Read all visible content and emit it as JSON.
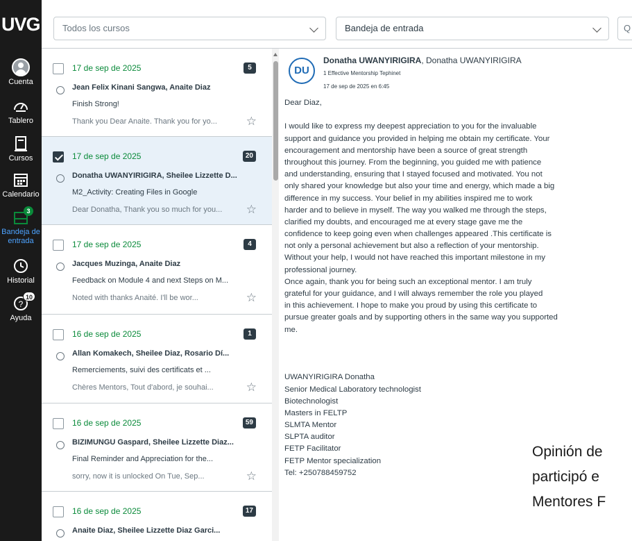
{
  "nav": {
    "logo": "UVG",
    "items": [
      {
        "label": "Cuenta",
        "icon": "account-icon"
      },
      {
        "label": "Tablero",
        "icon": "dashboard-icon"
      },
      {
        "label": "Cursos",
        "icon": "courses-icon"
      },
      {
        "label": "Calendario",
        "icon": "calendar-icon"
      },
      {
        "label": "Bandeja de entrada",
        "icon": "inbox-icon",
        "badge": "3"
      },
      {
        "label": "Historial",
        "icon": "history-icon"
      },
      {
        "label": "Ayuda",
        "icon": "help-icon",
        "badge": "10"
      }
    ]
  },
  "toolbar": {
    "course_filter": "Todos los cursos",
    "mailbox_filter": "Bandeja de entrada",
    "search_stub": "Q"
  },
  "conversations": [
    {
      "date": "17 de sep de 2025",
      "count": "5",
      "names": "Jean Felix Kinani Sangwa, Anaite Diaz",
      "subject": "Finish Strong!",
      "preview": "Thank you Dear Anaite. Thank you for yo...",
      "selected": false
    },
    {
      "date": "17 de sep de 2025",
      "count": "20",
      "names": "Donatha UWANYIRIGIRA, Sheilee Lizzette D...",
      "subject": "M2_Activity: Creating Files in Google",
      "preview": "Dear Donatha, Thank you so much for you...",
      "selected": true
    },
    {
      "date": "17 de sep de 2025",
      "count": "4",
      "names": "Jacques Muzinga, Anaite Diaz",
      "subject": "Feedback on Module 4 and next Steps on M...",
      "preview": "Noted with thanks Anaité. I'll be wor...",
      "selected": false
    },
    {
      "date": "16 de sep de 2025",
      "count": "1",
      "names": "Allan Komakech, Sheilee Diaz, Rosario Dí...",
      "subject": "Remerciements, suivi des certificats et ...",
      "preview": "Chères Mentors, Tout d'abord, je souhai...",
      "selected": false
    },
    {
      "date": "16 de sep de 2025",
      "count": "59",
      "names": "BIZIMUNGU Gaspard, Sheilee Lizzette Diaz...",
      "subject": "Final Reminder and Appreciation for the...",
      "preview": "sorry, now it is unlocked On Tue, Sep...",
      "selected": false
    },
    {
      "date": "16 de sep de 2025",
      "count": "17",
      "names": "Anaite Diaz, Sheilee Lizzette Diaz Garci...",
      "subject": "",
      "preview": "",
      "selected": false
    }
  ],
  "message": {
    "avatar_initials": "DU",
    "sender_bold": "Donatha UWANYIRIGIRA",
    "sender_rest": ", Donatha UWANYIRIGIRA",
    "course": "1 Effective Mentorship Tephinet",
    "sent": "17 de sep de 2025 en 6:45",
    "lines": [
      "Dear Diaz,",
      "",
      "I would like to express my deepest appreciation to you for the invaluable",
      "support and guidance you provided in helping me obtain my certificate. Your",
      "encouragement and mentorship have been a source of great strength",
      "throughout this journey. From the beginning, you guided me with patience",
      "and understanding, ensuring that I stayed focused and motivated. You not",
      "only shared your knowledge but also your time and energy, which made a big",
      "difference in my success. Your belief in my abilities inspired me to work",
      "harder and to believe in myself. The way you walked me through the steps,",
      "clarified my doubts, and encouraged me at every stage gave me the",
      "confidence to keep going even when challenges appeared .This certificate is",
      "not only a personal achievement but also a reflection of your mentorship.",
      "Without your help, I would not have reached this important milestone in my",
      "professional journey.",
      "Once again, thank you for being such an exceptional mentor. I am truly",
      "grateful for your guidance, and I will always remember the role you played",
      "in this achievement. I hope to make you proud by using this certificate to",
      "pursue greater goals and by supporting others in the same way you supported",
      "me.",
      "",
      "",
      "",
      "UWANYIRIGIRA Donatha",
      "Senior Medical Laboratory technologist",
      "Biotechnologist",
      "Masters in FELTP",
      "SLMTA Mentor",
      "SLPTA auditor",
      "FETP Facilitator",
      "FETP Mentor specialization",
      "Tel: +250788459752"
    ]
  },
  "overlay": {
    "line1": "Opinión de",
    "line2": "participó e",
    "line3": "Mentores F"
  }
}
